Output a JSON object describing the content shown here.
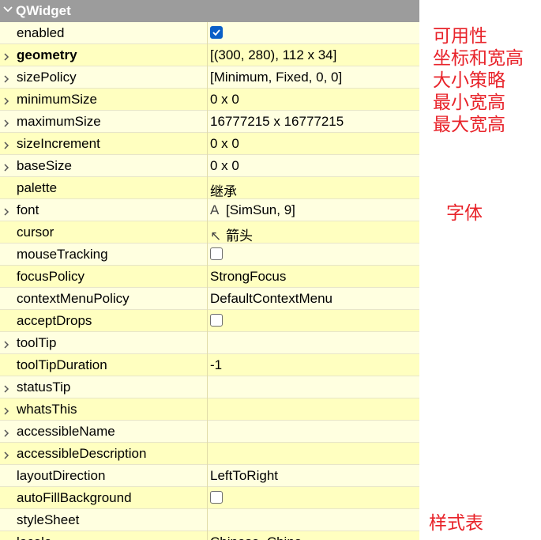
{
  "group": {
    "title": "QWidget"
  },
  "properties": [
    {
      "name": "enabled",
      "value": "",
      "expandable": false,
      "bold": false,
      "kind": "checkbox",
      "checked": true
    },
    {
      "name": "geometry",
      "value": "[(300, 280), 112 x 34]",
      "expandable": true,
      "bold": true,
      "kind": "text"
    },
    {
      "name": "sizePolicy",
      "value": "[Minimum, Fixed, 0, 0]",
      "expandable": true,
      "bold": false,
      "kind": "text"
    },
    {
      "name": "minimumSize",
      "value": "0 x 0",
      "expandable": true,
      "bold": false,
      "kind": "text"
    },
    {
      "name": "maximumSize",
      "value": "16777215 x 16777215",
      "expandable": true,
      "bold": false,
      "kind": "text"
    },
    {
      "name": "sizeIncrement",
      "value": "0 x 0",
      "expandable": true,
      "bold": false,
      "kind": "text"
    },
    {
      "name": "baseSize",
      "value": "0 x 0",
      "expandable": true,
      "bold": false,
      "kind": "text"
    },
    {
      "name": "palette",
      "value": "继承",
      "expandable": false,
      "bold": false,
      "kind": "text"
    },
    {
      "name": "font",
      "value": "[SimSun, 9]",
      "expandable": true,
      "bold": false,
      "kind": "font",
      "glyph": "A"
    },
    {
      "name": "cursor",
      "value": "箭头",
      "expandable": false,
      "bold": false,
      "kind": "cursor",
      "glyph": "↖"
    },
    {
      "name": "mouseTracking",
      "value": "",
      "expandable": false,
      "bold": false,
      "kind": "checkbox",
      "checked": false
    },
    {
      "name": "focusPolicy",
      "value": "StrongFocus",
      "expandable": false,
      "bold": false,
      "kind": "text"
    },
    {
      "name": "contextMenuPolicy",
      "value": "DefaultContextMenu",
      "expandable": false,
      "bold": false,
      "kind": "text"
    },
    {
      "name": "acceptDrops",
      "value": "",
      "expandable": false,
      "bold": false,
      "kind": "checkbox",
      "checked": false
    },
    {
      "name": "toolTip",
      "value": "",
      "expandable": true,
      "bold": false,
      "kind": "text"
    },
    {
      "name": "toolTipDuration",
      "value": "-1",
      "expandable": false,
      "bold": false,
      "kind": "text"
    },
    {
      "name": "statusTip",
      "value": "",
      "expandable": true,
      "bold": false,
      "kind": "text"
    },
    {
      "name": "whatsThis",
      "value": "",
      "expandable": true,
      "bold": false,
      "kind": "text"
    },
    {
      "name": "accessibleName",
      "value": "",
      "expandable": true,
      "bold": false,
      "kind": "text"
    },
    {
      "name": "accessibleDescription",
      "value": "",
      "expandable": true,
      "bold": false,
      "kind": "text"
    },
    {
      "name": "layoutDirection",
      "value": "LeftToRight",
      "expandable": false,
      "bold": false,
      "kind": "text"
    },
    {
      "name": "autoFillBackground",
      "value": "",
      "expandable": false,
      "bold": false,
      "kind": "checkbox",
      "checked": false
    },
    {
      "name": "styleSheet",
      "value": "",
      "expandable": false,
      "bold": false,
      "kind": "text"
    },
    {
      "name": "locale",
      "value": "Chinese, China",
      "expandable": false,
      "bold": false,
      "kind": "text"
    }
  ],
  "annotations": [
    {
      "text": "可用性",
      "row": 0
    },
    {
      "text": "坐标和宽高",
      "row": 1
    },
    {
      "text": "大小策略",
      "row": 2
    },
    {
      "text": "最小宽高",
      "row": 3
    },
    {
      "text": "最大宽高",
      "row": 4
    },
    {
      "text": "字体",
      "row": 8
    },
    {
      "text": "样式表",
      "row": 22
    }
  ],
  "colors": {
    "header_bg": "#9c9c9c",
    "row_odd": "#ffffe0",
    "row_even": "#ffffc0",
    "checkbox_checked": "#0a5fc7",
    "annotation": "#e8232a"
  },
  "icons": {
    "group_chevron": "chevron-down-icon",
    "row_expander": "chevron-right-icon",
    "checkbox_mark": "checkmark-icon"
  }
}
